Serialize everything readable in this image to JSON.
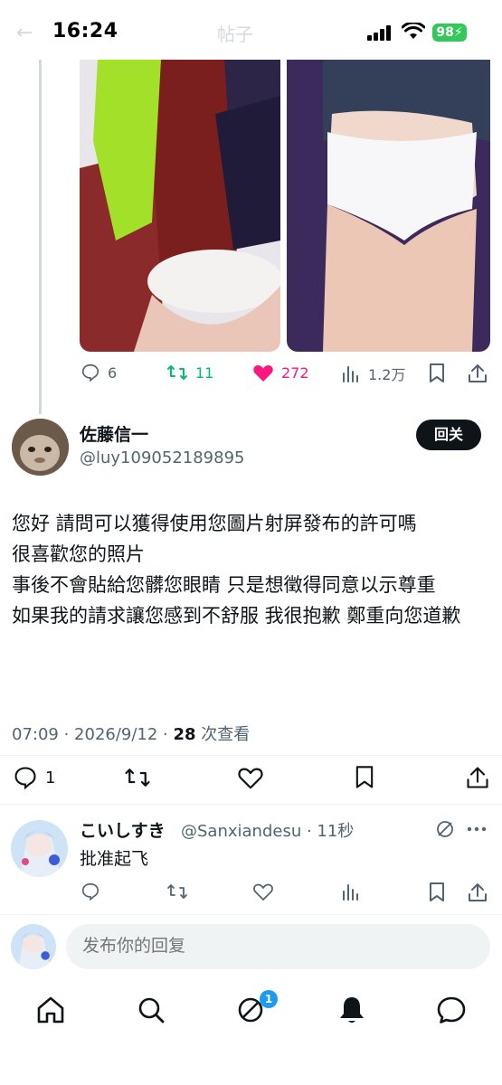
{
  "status": {
    "time": "16:24",
    "battery": "98",
    "page_title": "帖子"
  },
  "post_stats": {
    "replies": "6",
    "reposts": "11",
    "likes": "272",
    "views": "1.2万"
  },
  "reply": {
    "display_name": "佐藤信一",
    "handle": "@luy109052189895",
    "follow_label": "回关",
    "body_lines": [
      "您好 請問可以獲得使用您圖片射屏發布的許可嗎",
      "很喜歡您的照片",
      "事後不會貼給您髒您眼睛 只是想徵得同意以示尊重",
      "如果我的請求讓您感到不舒服 我很抱歉 鄭重向您道歉"
    ],
    "meta_time": "07:09 · 2026/9/12 · ",
    "meta_views_count": "28",
    "meta_views_label": " 次查看",
    "reply_count": "1"
  },
  "sub_reply": {
    "display_name": "こいしすき",
    "handle": "@Sanxiandesu · 11秒",
    "text": "批准起飞"
  },
  "composer": {
    "placeholder": "发布你的回复"
  },
  "nav": {
    "messages_badge": "1"
  },
  "colors": {
    "like_active": "#f91880",
    "repost_active": "#00ba7c",
    "accent": "#1d9bf0"
  }
}
